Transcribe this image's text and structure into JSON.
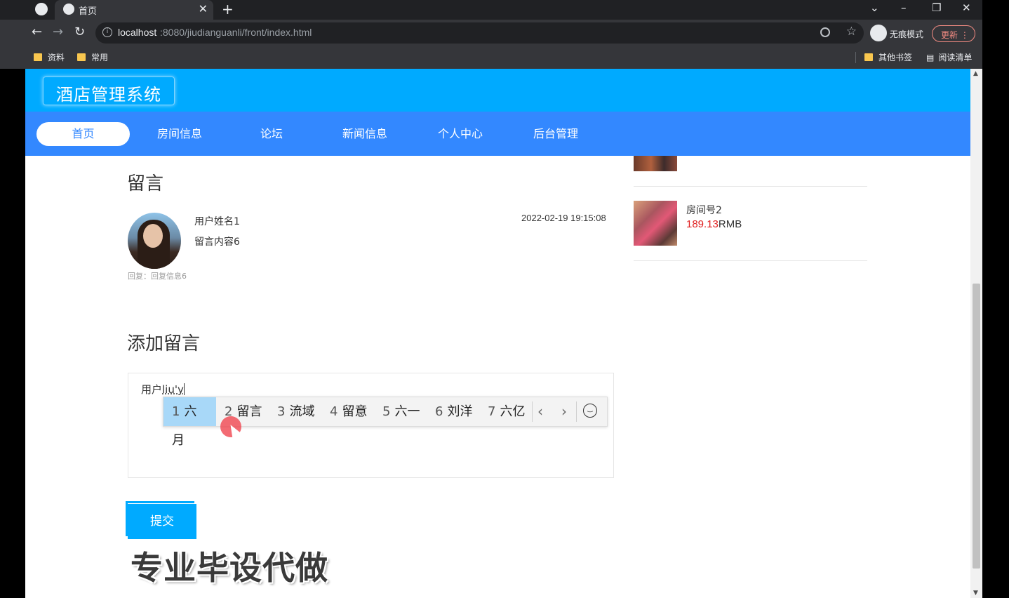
{
  "browser": {
    "tab_title": "首页",
    "url_host": "localhost",
    "url_path": ":8080/jiudianguanli/front/index.html",
    "incognito_label": "无痕模式",
    "update_label": "更新",
    "bookmarks": [
      "资料",
      "常用"
    ],
    "other_bookmarks": "其他书签",
    "reading_list": "阅读清单"
  },
  "site": {
    "logo": "酒店管理系统",
    "nav": [
      "首页",
      "房间信息",
      "论坛",
      "新闻信息",
      "个人中心",
      "后台管理"
    ]
  },
  "messages": {
    "title": "留言",
    "item": {
      "user": "用户姓名1",
      "content": "留言内容6",
      "time": "2022-02-19 19:15:08",
      "reply": "回复：回复信息6"
    }
  },
  "rooms": [
    {
      "name": "房间号2",
      "price": "189.13",
      "unit": "RMB"
    }
  ],
  "add_message": {
    "title": "添加留言",
    "typed_text": "用户",
    "composing": "liu'y",
    "submit": "提交"
  },
  "ime": {
    "candidates": [
      {
        "n": "1",
        "text": "六月"
      },
      {
        "n": "2",
        "text": "留言"
      },
      {
        "n": "3",
        "text": "流域"
      },
      {
        "n": "4",
        "text": "留意"
      },
      {
        "n": "5",
        "text": "六一"
      },
      {
        "n": "6",
        "text": "刘洋"
      },
      {
        "n": "7",
        "text": "六亿"
      }
    ],
    "selected_index": 0
  },
  "watermark": "专业毕设代做",
  "colors": {
    "header": "#00aaff",
    "navbar": "#3388ff",
    "price": "#e02020"
  }
}
